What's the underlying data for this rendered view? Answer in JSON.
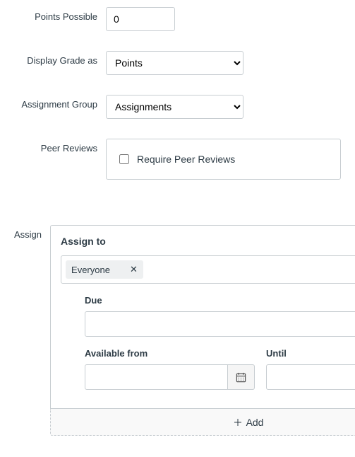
{
  "points": {
    "label": "Points Possible",
    "value": "0"
  },
  "display_grade": {
    "label": "Display Grade as",
    "value": "Points"
  },
  "assignment_group": {
    "label": "Assignment Group",
    "value": "Assignments"
  },
  "peer_reviews": {
    "label": "Peer Reviews",
    "checkbox_label": "Require Peer Reviews"
  },
  "assign": {
    "label": "Assign",
    "section_title": "Assign to",
    "token": "Everyone",
    "due_label": "Due",
    "due_value": "",
    "available_label": "Available from",
    "available_value": "",
    "until_label": "Until",
    "until_value": "",
    "add_label": "Add"
  }
}
